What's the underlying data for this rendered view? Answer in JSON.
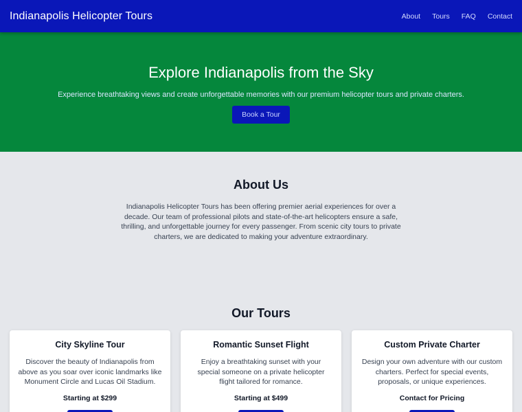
{
  "nav": {
    "brand": "Indianapolis Helicopter Tours",
    "links": [
      "About",
      "Tours",
      "FAQ",
      "Contact"
    ]
  },
  "hero": {
    "title": "Explore Indianapolis from the Sky",
    "subtitle": "Experience breathtaking views and create unforgettable memories with our premium helicopter tours and private charters.",
    "cta": "Book a Tour"
  },
  "about": {
    "title": "About Us",
    "text": "Indianapolis Helicopter Tours has been offering premier aerial experiences for over a decade. Our team of professional pilots and state-of-the-art helicopters ensure a safe, thrilling, and unforgettable journey for every passenger. From scenic city tours to private charters, we are dedicated to making your adventure extraordinary."
  },
  "tours": {
    "title": "Our Tours",
    "items": [
      {
        "title": "City Skyline Tour",
        "desc": "Discover the beauty of Indianapolis from above as you soar over iconic landmarks like Monument Circle and Lucas Oil Stadium.",
        "price": "Starting at $299"
      },
      {
        "title": "Romantic Sunset Flight",
        "desc": "Enjoy a breathtaking sunset with your special someone on a private helicopter flight tailored for romance.",
        "price": "Starting at $499"
      },
      {
        "title": "Custom Private Charter",
        "desc": "Design your own adventure with our custom charters. Perfect for special events, proposals, or unique experiences.",
        "price": "Contact for Pricing"
      }
    ]
  },
  "colors": {
    "nav_bg": "#0a17b8",
    "hero_bg": "#05873c",
    "page_bg": "#e5e7eb",
    "card_bg": "#ffffff"
  }
}
